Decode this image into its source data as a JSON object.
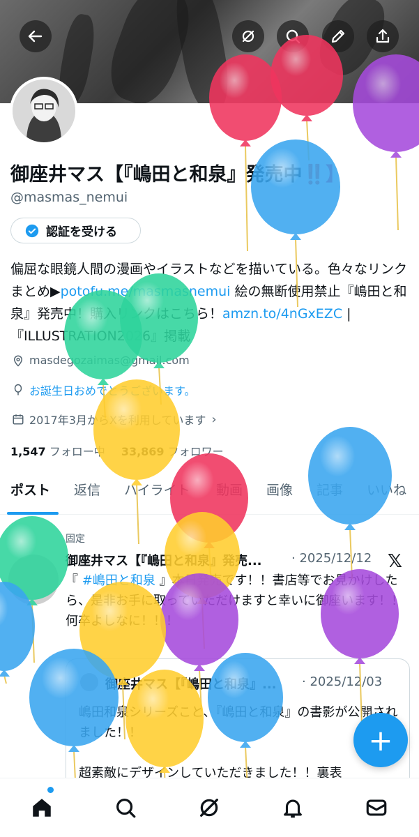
{
  "header": {
    "back_icon": "arrow-left-icon",
    "grok_icon": "grok-icon",
    "search_icon": "search-icon",
    "edit_icon": "pencil-icon",
    "share_icon": "share-icon"
  },
  "profile": {
    "name": "御座井マス【『嶋田と和泉』発売中",
    "name_suffix": "‼️】",
    "handle": "@masmas_nemui",
    "verify_label": "認証を受ける",
    "bio_part1": "偏屈な眼鏡人間の漫画やイラストなどを描いている。色々なリンクまとめ▶",
    "bio_link1": "potofu.me/masmasnemui",
    "bio_part2": " 絵の無断使用禁止『嶋田と和泉』発売中！購入リンクはこちら！",
    "bio_link2": "amzn.to/4nGxEZC",
    "bio_part3": " |『ILLUSTRATION2026』掲載",
    "email": "masdegozaimas@gmail.com",
    "birthday": "お誕生日おめでとうございます。",
    "joined": "2017年3月からXを利用しています",
    "following_count": "1,547",
    "following_label": "フォロー中",
    "followers_count": "33,869",
    "followers_label": "フォロワー"
  },
  "tabs": [
    {
      "label": "ポスト"
    },
    {
      "label": "返信"
    },
    {
      "label": "ハイライト"
    },
    {
      "label": "動画"
    },
    {
      "label": "画像"
    },
    {
      "label": "記事"
    },
    {
      "label": "いいね"
    }
  ],
  "post": {
    "pinned_label": "固定",
    "author": "御座井マス【『嶋田と和泉』発売...",
    "date": "· 2025/12/12",
    "text_prefix": "『 ",
    "hashtag": "#嶋田と和泉",
    "text_rest": " 』本日発売です！！書店等でお見かけしたら、是非お手に取っていただけますと幸いに御座います！！何卒よしなに！！！",
    "quote": {
      "author": "御座井マス【『嶋田と和泉』...",
      "date": "· 2025/12/03",
      "text": "嶋田和泉シリーズこと、『嶋田と和泉』の書影が公開されました！！\n\n超素敵にデザインしていただきました！！裏表"
    }
  },
  "fab_label": "+",
  "colors": {
    "accent": "#1d9bf0",
    "balloon_red": "#f0355e",
    "balloon_blue": "#3aa6f0",
    "balloon_purple": "#a64bdc",
    "balloon_green": "#2ed49c",
    "balloon_yellow": "#ffcd2e"
  }
}
